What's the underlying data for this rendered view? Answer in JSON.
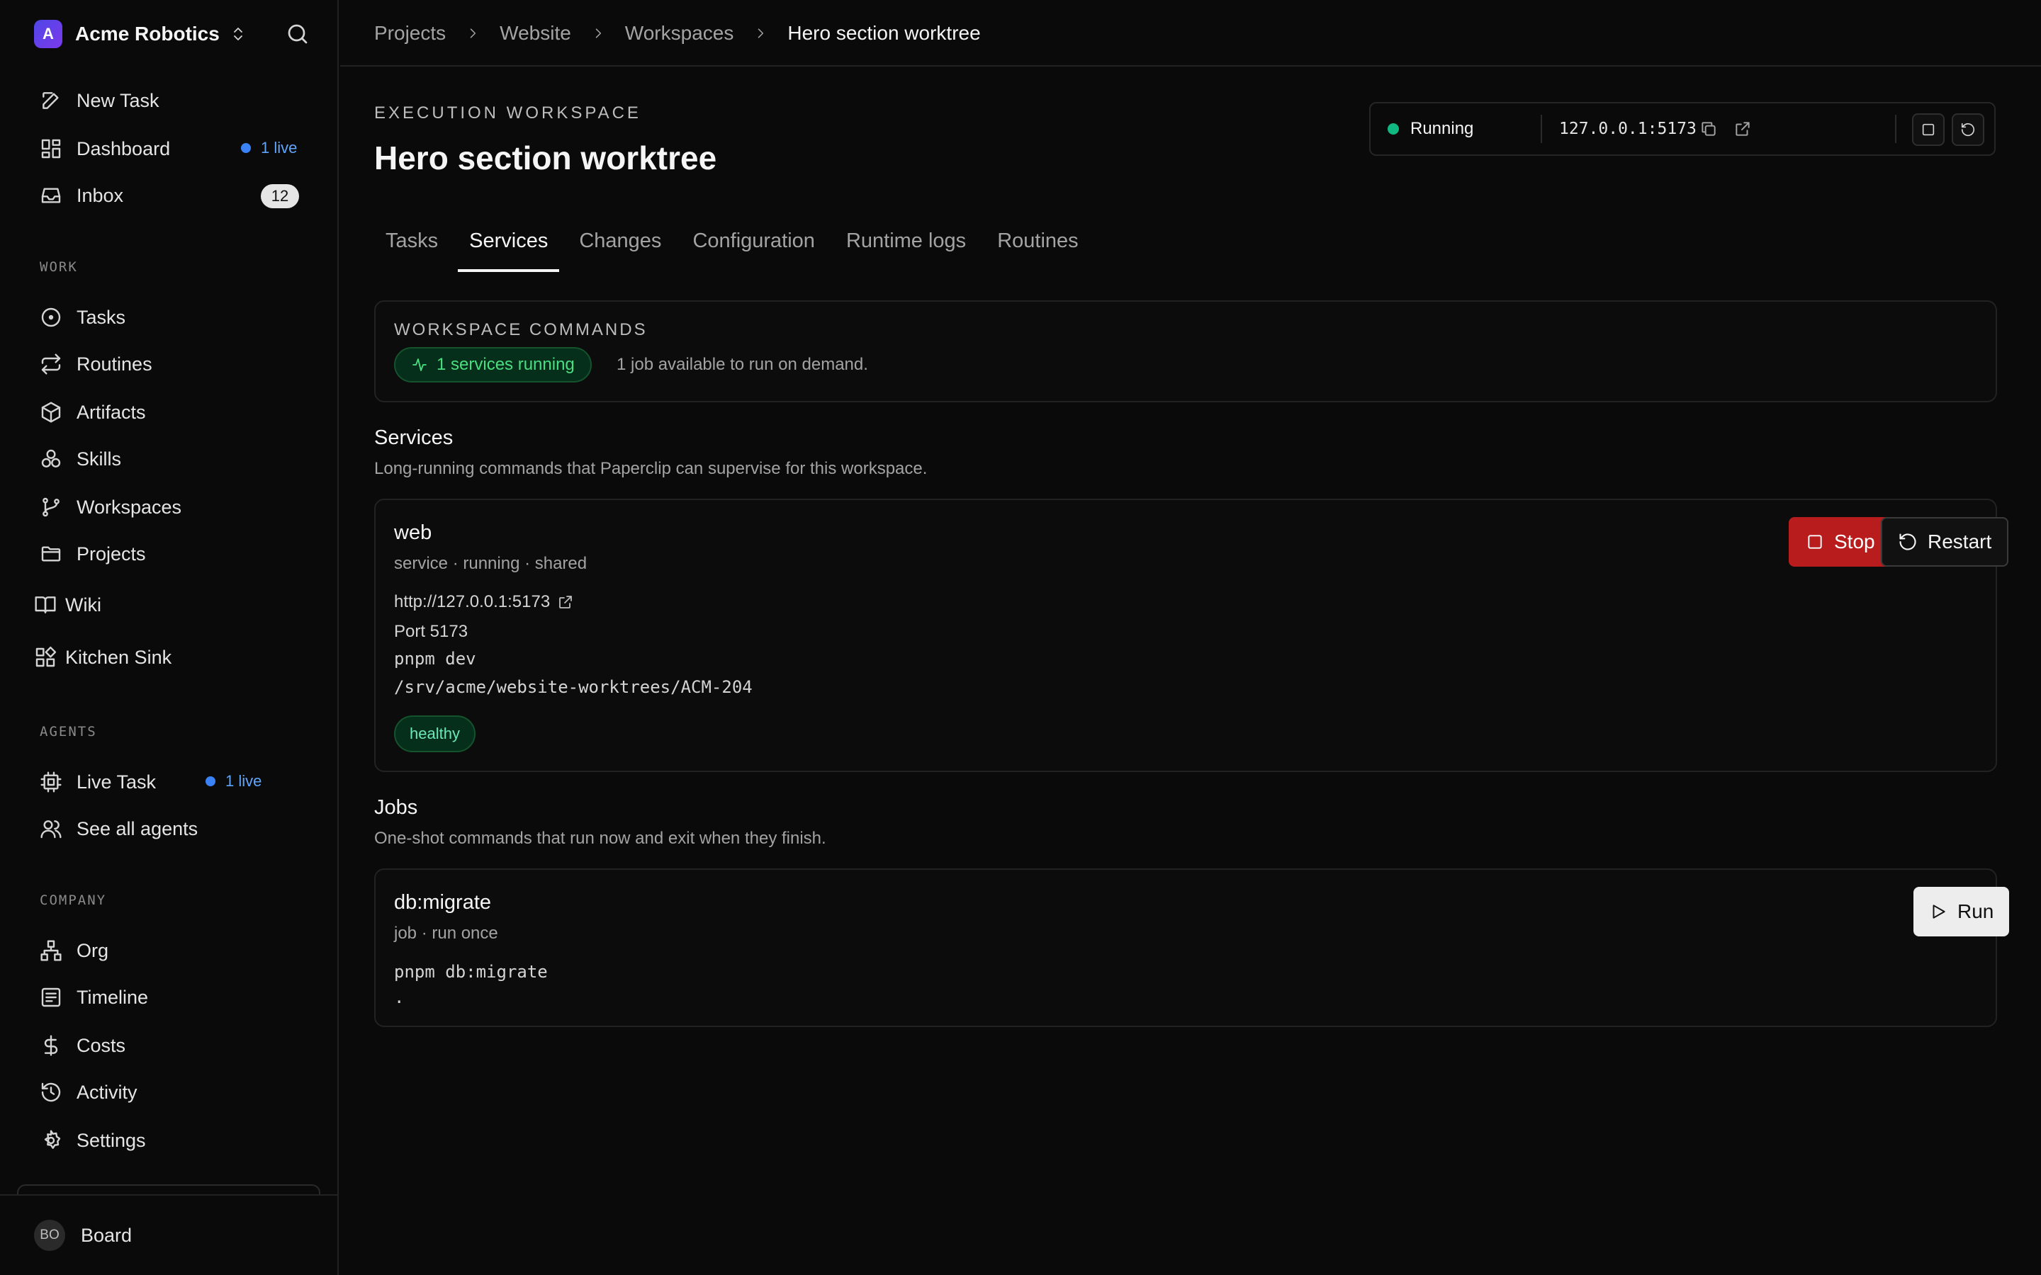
{
  "sidebar": {
    "company": {
      "initial": "A",
      "name": "Acme Robotics"
    },
    "top_items": [
      {
        "label": "New Task",
        "icon": "edit-icon"
      },
      {
        "label": "Dashboard",
        "icon": "dashboard-icon",
        "live": "1 live"
      },
      {
        "label": "Inbox",
        "icon": "inbox-icon",
        "count": "12"
      }
    ],
    "work_heading": "WORK",
    "work_items": [
      {
        "label": "Tasks",
        "icon": "circle-dot-icon"
      },
      {
        "label": "Routines",
        "icon": "repeat-icon"
      },
      {
        "label": "Artifacts",
        "icon": "box-icon"
      },
      {
        "label": "Skills",
        "icon": "boxes-icon"
      },
      {
        "label": "Workspaces",
        "icon": "git-branch-icon"
      },
      {
        "label": "Projects",
        "icon": "folder-icon"
      }
    ],
    "extra_items": [
      {
        "label": "Wiki",
        "icon": "book-icon"
      },
      {
        "label": "Kitchen Sink",
        "icon": "blocks-icon"
      }
    ],
    "agents_heading": "AGENTS",
    "agent_items": [
      {
        "label": "Live Task",
        "icon": "cpu-icon",
        "live": "1 live"
      },
      {
        "label": "See all agents",
        "icon": "users-icon"
      }
    ],
    "company_heading": "COMPANY",
    "company_items": [
      {
        "label": "Org",
        "icon": "org-chart-icon"
      },
      {
        "label": "Timeline",
        "icon": "list-icon"
      },
      {
        "label": "Costs",
        "icon": "dollar-icon"
      },
      {
        "label": "Activity",
        "icon": "history-icon"
      },
      {
        "label": "Settings",
        "icon": "gear-icon"
      }
    ],
    "user": {
      "initials": "BO",
      "name": "Board"
    }
  },
  "breadcrumbs": [
    "Projects",
    "Website",
    "Workspaces",
    "Hero section worktree"
  ],
  "page": {
    "eyebrow": "EXECUTION WORKSPACE",
    "title": "Hero section worktree"
  },
  "runtime": {
    "status": "Running",
    "url": "127.0.0.1:5173",
    "status_color": "#10b981"
  },
  "tabs": [
    "Tasks",
    "Services",
    "Changes",
    "Configuration",
    "Runtime logs",
    "Routines"
  ],
  "active_tab": "Services",
  "commands": {
    "heading": "WORKSPACE COMMANDS",
    "running_pill": "1 services running",
    "note": "1 job available to run on demand."
  },
  "services": {
    "title": "Services",
    "description": "Long-running commands that Paperclip can supervise for this workspace.",
    "items": [
      {
        "name": "web",
        "meta": "service · running · shared",
        "url": "http://127.0.0.1:5173",
        "port": "Port 5173",
        "command": "pnpm dev",
        "path": "/srv/acme/website-worktrees/ACM-204",
        "health": "healthy",
        "stop_label": "Stop",
        "restart_label": "Restart"
      }
    ]
  },
  "jobs": {
    "title": "Jobs",
    "description": "One-shot commands that run now and exit when they finish.",
    "items": [
      {
        "name": "db:migrate",
        "meta": "job · run once",
        "command": "pnpm db:migrate",
        "cwd": ".",
        "run_label": "Run"
      }
    ]
  },
  "colors": {
    "background": "#0a0a0a",
    "accent_live": "#3b82f6",
    "stop_button": "#b91c1c",
    "healthy": "#10b981"
  }
}
